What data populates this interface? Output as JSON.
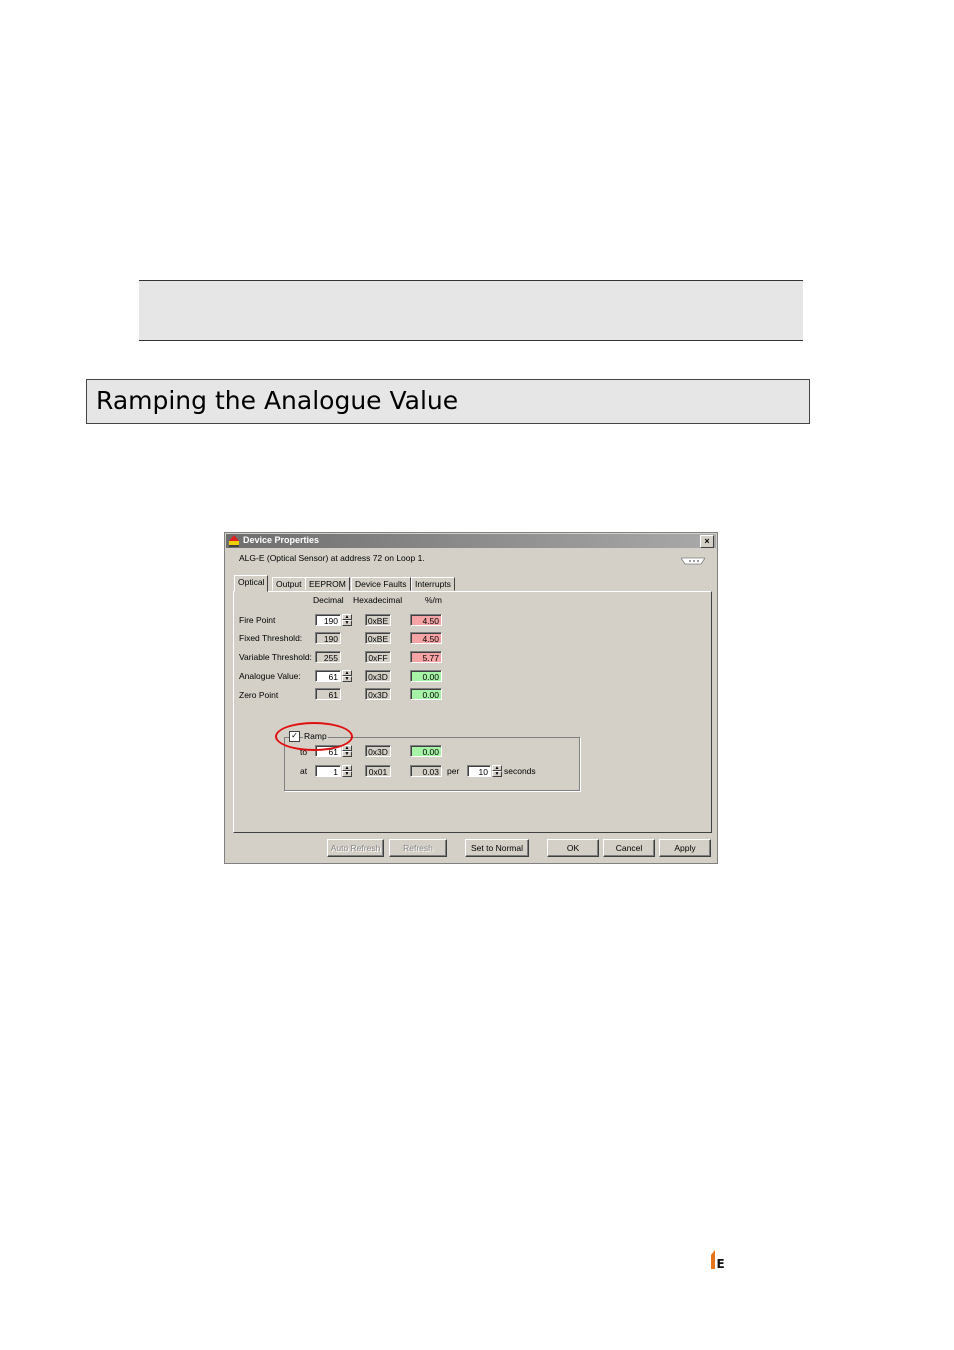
{
  "section": {
    "heading": "Ramping the Analogue Value"
  },
  "dialog": {
    "title": "Device Properties",
    "close_glyph": "×",
    "subtitle": "ALG-E (Optical Sensor) at address 72 on Loop 1.",
    "tabs": [
      "Optical",
      "Output",
      "EEPROM",
      "Device Faults",
      "Interrupts"
    ],
    "columns": {
      "decimal": "Decimal",
      "hex": "Hexadecimal",
      "pct": "%/m"
    },
    "rows": [
      {
        "label": "Fire Point",
        "decimal": "190",
        "hex": "0xBE",
        "pct": "4.50",
        "pct_color": "pink",
        "editable": true
      },
      {
        "label": "Fixed Threshold:",
        "decimal": "190",
        "hex": "0xBE",
        "pct": "4.50",
        "pct_color": "pink",
        "editable": false
      },
      {
        "label": "Variable Threshold:",
        "decimal": "255",
        "hex": "0xFF",
        "pct": "5.77",
        "pct_color": "pink",
        "editable": false
      },
      {
        "label": "Analogue Value:",
        "decimal": "61",
        "hex": "0x3D",
        "pct": "0.00",
        "pct_color": "green",
        "editable": true
      },
      {
        "label": "Zero Point",
        "decimal": "61",
        "hex": "0x3D",
        "pct": "0.00",
        "pct_color": "green",
        "editable": false
      }
    ],
    "ramp": {
      "label": "Ramp",
      "checked": "✓",
      "to": {
        "label": "to",
        "decimal": "61",
        "hex": "0x3D",
        "pct": "0.00"
      },
      "at": {
        "label": "at",
        "decimal": "1",
        "hex": "0x01",
        "pct": "0.03"
      },
      "per_label": "per",
      "per_value": "10",
      "seconds_label": "seconds"
    },
    "buttons": {
      "auto_refresh": "Auto Refresh",
      "refresh": "Refresh",
      "set_normal": "Set to Normal",
      "ok": "OK",
      "cancel": "Cancel",
      "apply": "Apply"
    }
  },
  "colors": {
    "pink_field": "#f4a4a4",
    "green_field": "#a6f2a6",
    "highlight": "#e01010",
    "logo": "#e8751a"
  }
}
